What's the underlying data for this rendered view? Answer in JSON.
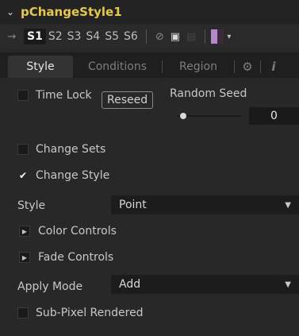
{
  "header": {
    "title": "pChangeStyle1",
    "collapse_icon": "chevron-down-icon"
  },
  "toolbar": {
    "pin_icon": "pin-icon",
    "slots": [
      "S1",
      "S2",
      "S3",
      "S4",
      "S5",
      "S6"
    ],
    "active_slot": "S1",
    "icons": [
      "disable-icon",
      "lock-icon",
      "view-icon"
    ],
    "color_swatch_fill": "#b28ac9",
    "color_swatch_dark": "#3a2a3a"
  },
  "tabs": [
    {
      "label": "Style",
      "active": true
    },
    {
      "label": "Conditions",
      "active": false
    },
    {
      "label": "Region",
      "active": false
    },
    {
      "label": "⚙",
      "active": false,
      "icon": "gear-icon"
    },
    {
      "label": "ℹ",
      "active": false,
      "icon": "info-icon"
    }
  ],
  "controls": {
    "time_lock": {
      "label": "Time Lock",
      "checked": false
    },
    "reseed_button": "Reseed",
    "random_seed": {
      "label": "Random Seed",
      "value": "0",
      "slider_fraction": 0.0
    },
    "change_sets": {
      "label": "Change Sets",
      "checked": false
    },
    "change_style": {
      "label": "Change Style",
      "checked": true
    },
    "style": {
      "label": "Style",
      "value": "Point"
    },
    "color_controls": {
      "label": "Color Controls",
      "expanded": false
    },
    "fade_controls": {
      "label": "Fade Controls",
      "expanded": false
    },
    "apply_mode": {
      "label": "Apply Mode",
      "value": "Add"
    },
    "sub_pixel": {
      "label": "Sub-Pixel Rendered",
      "checked": false
    }
  },
  "colors": {
    "title": "#e6c84e",
    "background": "#282828"
  }
}
